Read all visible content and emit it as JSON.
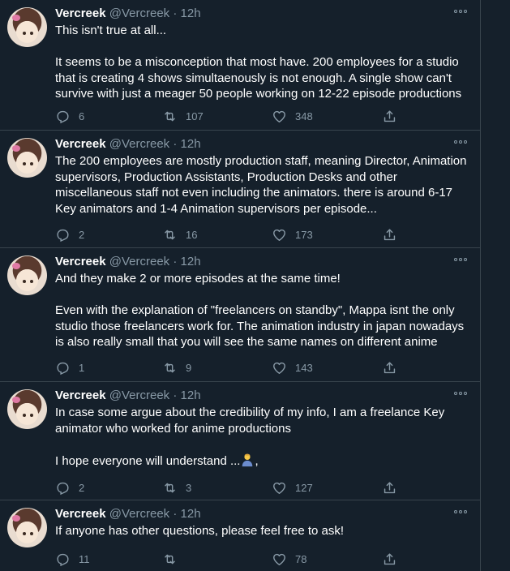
{
  "tweets": [
    {
      "name": "Vercreek",
      "handle": "@Vercreek",
      "dot": "·",
      "time": "12h",
      "paragraphs": [
        "This isn't true at all...",
        "It seems to be a misconception that most have. 200 employees for a studio that is creating 4 shows simultaenously is not enough. A single show can't survive with just a meager 50 people working on 12-22 episode productions"
      ],
      "replies": "6",
      "retweets": "107",
      "likes": "348"
    },
    {
      "name": "Vercreek",
      "handle": "@Vercreek",
      "dot": "·",
      "time": "12h",
      "paragraphs": [
        "The 200 employees are mostly production staff, meaning Director, Animation supervisors, Production Assistants, Production Desks and other miscellaneous staff not even including the animators. there is around 6-17 Key animators and 1-4 Animation supervisors per episode..."
      ],
      "replies": "2",
      "retweets": "16",
      "likes": "173"
    },
    {
      "name": "Vercreek",
      "handle": "@Vercreek",
      "dot": "·",
      "time": "12h",
      "paragraphs": [
        "And they make 2 or more episodes at the same time!",
        "Even with the explanation of \"freelancers on standby\", Mappa isnt the only studio those freelancers work for. The animation industry in japan nowadays is also really small that you will see the same names on different anime"
      ],
      "replies": "1",
      "retweets": "9",
      "likes": "143"
    },
    {
      "name": "Vercreek",
      "handle": "@Vercreek",
      "dot": "·",
      "time": "12h",
      "paragraphs": [
        "In case some argue about the credibility of my info, I am a freelance Key animator who worked for anime productions"
      ],
      "last_line_prefix": "I hope everyone will understand ...",
      "last_line_suffix": ",",
      "last_line_emoji": "person-bowing-emoji",
      "replies": "2",
      "retweets": "3",
      "likes": "127"
    },
    {
      "name": "Vercreek",
      "handle": "@Vercreek",
      "dot": "·",
      "time": "12h",
      "paragraphs": [
        "If anyone has other questions, please feel free to ask!"
      ],
      "replies": "11",
      "retweets": "",
      "likes": "78"
    }
  ],
  "colors": {
    "background": "#15202b",
    "text": "#ffffff",
    "secondary": "#8899a6",
    "border": "#38444d"
  }
}
